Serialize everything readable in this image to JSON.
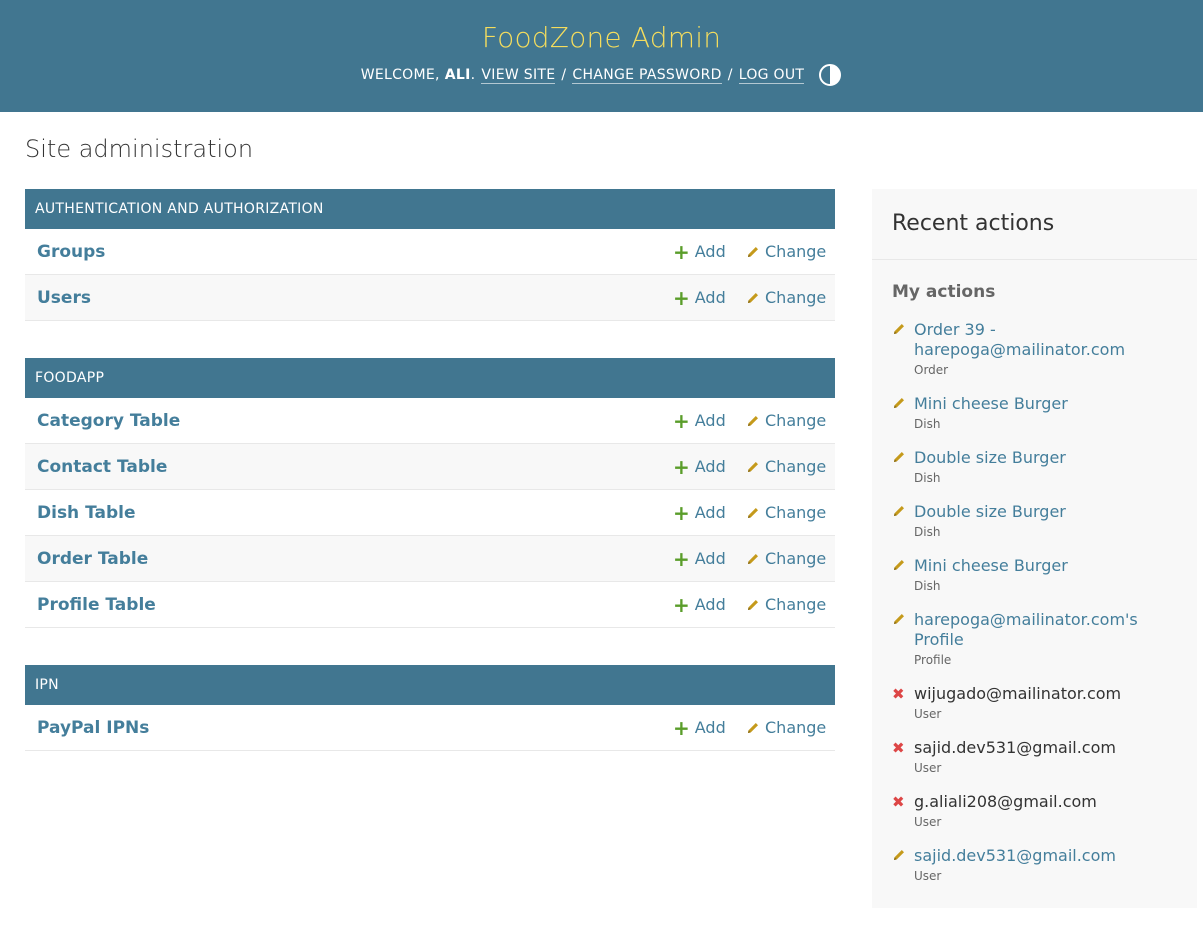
{
  "header": {
    "site_name": "FoodZone Admin",
    "welcome": "WELCOME,",
    "username": "ALI",
    "view_site": "VIEW SITE",
    "change_password": "CHANGE PASSWORD",
    "log_out": "LOG OUT",
    "separator": "/"
  },
  "page_title": "Site administration",
  "modules": [
    {
      "caption": "AUTHENTICATION AND AUTHORIZATION",
      "models": [
        {
          "name": "Groups",
          "add": "Add",
          "change": "Change"
        },
        {
          "name": "Users",
          "add": "Add",
          "change": "Change"
        }
      ]
    },
    {
      "caption": "FOODAPP",
      "models": [
        {
          "name": "Category Table",
          "add": "Add",
          "change": "Change"
        },
        {
          "name": "Contact Table",
          "add": "Add",
          "change": "Change"
        },
        {
          "name": "Dish Table",
          "add": "Add",
          "change": "Change"
        },
        {
          "name": "Order Table",
          "add": "Add",
          "change": "Change"
        },
        {
          "name": "Profile Table",
          "add": "Add",
          "change": "Change"
        }
      ]
    },
    {
      "caption": "IPN",
      "models": [
        {
          "name": "PayPal IPNs",
          "add": "Add",
          "change": "Change"
        }
      ]
    }
  ],
  "recent_actions": {
    "title": "Recent actions",
    "subtitle": "My actions",
    "items": [
      {
        "action": "change",
        "icon": "pencil-icon",
        "label": "Order 39 - harepoga@mailinator.com",
        "type": "Order"
      },
      {
        "action": "change",
        "icon": "pencil-icon",
        "label": "Mini cheese Burger",
        "type": "Dish"
      },
      {
        "action": "change",
        "icon": "pencil-icon",
        "label": "Double size Burger",
        "type": "Dish"
      },
      {
        "action": "change",
        "icon": "pencil-icon",
        "label": "Double size Burger",
        "type": "Dish"
      },
      {
        "action": "change",
        "icon": "pencil-icon",
        "label": "Mini cheese Burger",
        "type": "Dish"
      },
      {
        "action": "change",
        "icon": "pencil-icon",
        "label": "harepoga@mailinator.com's Profile",
        "type": "Profile"
      },
      {
        "action": "delete",
        "icon": "delete-icon",
        "label": "wijugado@mailinator.com",
        "type": "User"
      },
      {
        "action": "delete",
        "icon": "delete-icon",
        "label": "sajid.dev531@gmail.com",
        "type": "User"
      },
      {
        "action": "delete",
        "icon": "delete-icon",
        "label": "g.aliali208@gmail.com",
        "type": "User"
      },
      {
        "action": "change",
        "icon": "pencil-icon",
        "label": "sajid.dev531@gmail.com",
        "type": "User"
      }
    ]
  },
  "colors": {
    "header_bg": "#417690",
    "site_name": "#f5dd5d",
    "link": "#447e9b",
    "add_icon": "#5a9d2a",
    "change_icon": "#c59a1b",
    "delete_icon": "#dd4646"
  }
}
